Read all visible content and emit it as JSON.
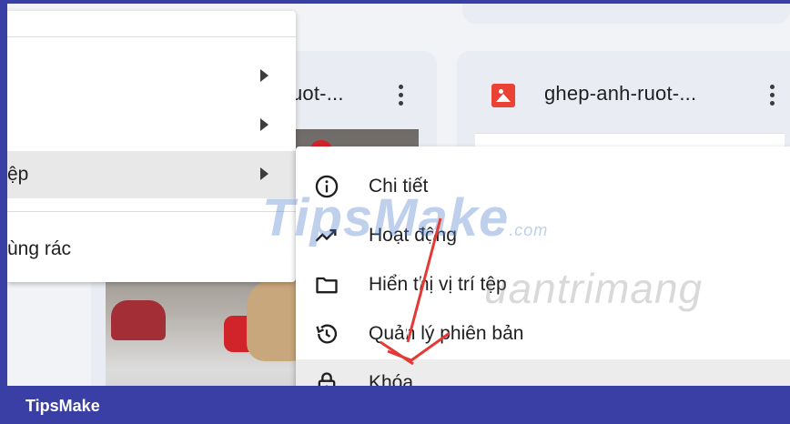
{
  "cards": [
    {
      "title": "uot-...",
      "menu_icon": "more-vert-icon"
    },
    {
      "title": "ghep-anh-ruot-...",
      "file_icon": "image-file-icon",
      "menu_icon": "more-vert-icon"
    }
  ],
  "left_menu": {
    "items": [
      {
        "label": "",
        "has_submenu": true
      },
      {
        "label": "",
        "has_submenu": true
      },
      {
        "label": "ệp",
        "has_submenu": true,
        "active": true
      },
      {
        "label": "ùng rác",
        "has_submenu": false
      }
    ]
  },
  "submenu": {
    "items": [
      {
        "label": "Chi tiết",
        "icon": "info-icon"
      },
      {
        "label": "Hoạt động",
        "icon": "activity-icon"
      },
      {
        "label": "Hiển thị vị trí tệp",
        "icon": "folder-icon"
      },
      {
        "label": "Quản lý phiên bản",
        "icon": "history-icon"
      },
      {
        "label": "Khóa",
        "icon": "lock-icon",
        "hover": true
      }
    ]
  },
  "watermarks": {
    "tipsmake": "TipsMake",
    "tipsmake_suffix": ".com",
    "quantrimang": "uantrimang"
  },
  "footer": {
    "brand": "TipsMake"
  },
  "colors": {
    "footer_bg": "#3a3fa6",
    "image_icon": "#ea4335",
    "arrow": "#e53935"
  }
}
